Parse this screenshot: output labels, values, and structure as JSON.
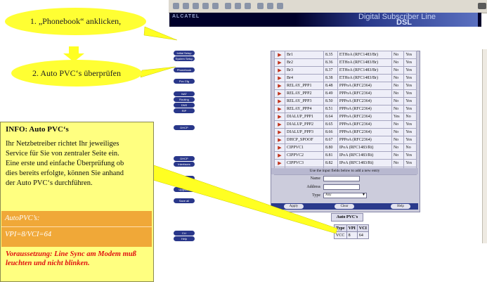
{
  "callouts": {
    "step1": "1. „Phonebook“ anklicken,",
    "step2": "2. Auto PVC‘s überprüfen"
  },
  "info": {
    "title": "INFO: Auto PVC‘s",
    "text": "Ihr Netzbetreiber richtet Ihr jeweiliges Service für Sie von zentraler Seite ein. Eine erste und einfache Überprüfung ob dies bereits erfolgte, können Sie anhand der Auto PVC‘s durchführen.",
    "pvc_label": "AutoPVC’s:",
    "pvc_value": "VPI=8/VCI=64",
    "requirement": "Voraussetzung: Line Sync am Modem muß leuchten und nicht blinken."
  },
  "app": {
    "brand": "ALCATEL",
    "title_line1": "Digital Subscriber Line",
    "title_line2": "DSL"
  },
  "nav": [
    "Initial Setup",
    "System Setup",
    "Phonebook",
    "Pvc Cfg",
    "NAT",
    "Routing",
    "DNS",
    "RIP",
    "DHCP",
    "DHCP",
    "Interfaces",
    "Wireless",
    "Upgrade",
    "Save all",
    "CLI",
    "Help"
  ],
  "phonebook": {
    "rows": [
      [
        "Br1",
        "8.35",
        "ETHoA (RFC1483/Br)",
        "No",
        "Yes"
      ],
      [
        "Br2",
        "8.36",
        "ETHoA (RFC1483/Br)",
        "No",
        "Yes"
      ],
      [
        "Br3",
        "8.37",
        "ETHoA (RFC1483/Br)",
        "No",
        "Yes"
      ],
      [
        "Br4",
        "8.38",
        "ETHoA (RFC1483/Br)",
        "No",
        "Yes"
      ],
      [
        "RELAY_PPP1",
        "8.48",
        "PPPoA (RFC2364)",
        "No",
        "Yes"
      ],
      [
        "RELAY_PPP2",
        "8.49",
        "PPPoA (RFC2364)",
        "No",
        "Yes"
      ],
      [
        "RELAY_PPP3",
        "8.50",
        "PPPoA (RFC2364)",
        "No",
        "Yes"
      ],
      [
        "RELAY_PPP4",
        "8.51",
        "PPPoA (RFC2364)",
        "No",
        "Yes"
      ],
      [
        "DIALUP_PPP1",
        "8.64",
        "PPPoA (RFC2364)",
        "Yes",
        "No"
      ],
      [
        "DIALUP_PPP2",
        "8.65",
        "PPPoA (RFC2364)",
        "No",
        "Yes"
      ],
      [
        "DIALUP_PPP3",
        "8.66",
        "PPPoA (RFC2364)",
        "No",
        "Yes"
      ],
      [
        "DHCP_SPOOF",
        "8.67",
        "PPPoA (RFC2364)",
        "No",
        "Yes"
      ],
      [
        "CIPPVC1",
        "8.80",
        "IPoA (RFC1483/Rt)",
        "No",
        "No"
      ],
      [
        "CIPPVC2",
        "8.81",
        "IPoA (RFC1483/Rt)",
        "No",
        "Yes"
      ],
      [
        "CIPPVC3",
        "8.82",
        "IPoA (RFC1483/Rt)",
        "No",
        "Yes"
      ],
      [
        "CIPPVC4",
        "8.83",
        "IPoA (RFC1483/Rt)",
        "No",
        "Yes"
      ]
    ],
    "hint": "Use the input fields below to add a new entry",
    "name_label": "Name",
    "address_label": "Address",
    "type_label": "Type",
    "type_value": "Any",
    "buttons": [
      "Apply",
      "Clear",
      "Help"
    ]
  },
  "auto_pvc": {
    "title": "Auto PVC's",
    "headers": [
      "Type",
      "VPI",
      "VCI"
    ],
    "row": [
      "VCC",
      "8",
      "64"
    ]
  }
}
